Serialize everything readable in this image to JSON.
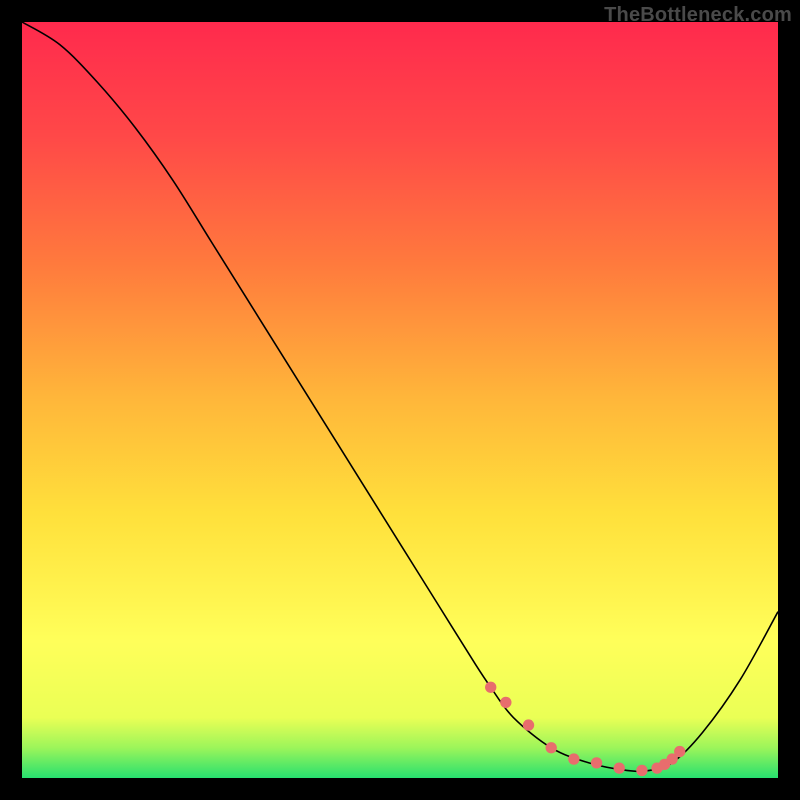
{
  "watermark": "TheBottleneck.com",
  "colors": {
    "background": "#000000",
    "gradient_top": "#ff2a4d",
    "gradient_mid_upper": "#ff7a3d",
    "gradient_mid": "#ffd23b",
    "gradient_lower": "#ffff5a",
    "gradient_bottom": "#27e06f",
    "curve": "#000000",
    "marker": "#e86d6d",
    "watermark_text": "#4a4a4a"
  },
  "chart_data": {
    "type": "line",
    "title": "",
    "xlabel": "",
    "ylabel": "",
    "xlim": [
      0,
      100
    ],
    "ylim": [
      0,
      100
    ],
    "grid": false,
    "legend": null,
    "series": [
      {
        "name": "bottleneck-curve",
        "x": [
          0,
          5,
          10,
          15,
          20,
          25,
          30,
          35,
          40,
          45,
          50,
          55,
          60,
          62,
          65,
          70,
          75,
          80,
          83,
          86,
          90,
          95,
          100
        ],
        "y": [
          100,
          97,
          92,
          86,
          79,
          71,
          63,
          55,
          47,
          39,
          31,
          23,
          15,
          12,
          8,
          4,
          2,
          1,
          1,
          2,
          6,
          13,
          22
        ]
      }
    ],
    "markers": {
      "name": "optimal-region",
      "x": [
        62,
        64,
        67,
        70,
        73,
        76,
        79,
        82,
        84,
        85,
        86,
        87
      ],
      "y": [
        12,
        10,
        7,
        4,
        2.5,
        2,
        1.3,
        1,
        1.3,
        1.8,
        2.5,
        3.5
      ]
    }
  }
}
